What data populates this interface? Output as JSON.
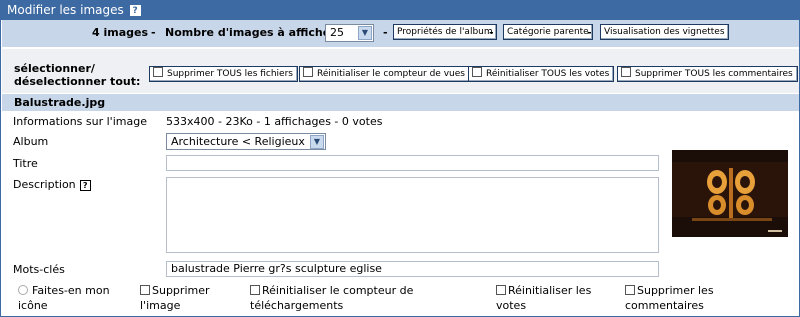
{
  "titlebar": {
    "title": "Modifier les images",
    "help": "?"
  },
  "toolbar": {
    "count": "4 images",
    "sep": "-",
    "per_page_label": "Nombre d'images à afficher",
    "per_page_value": "25",
    "album_props": "Propriétés de l'album",
    "parent_category": "Catégorie parente",
    "view_thumbs": "Visualisation des vignettes"
  },
  "select_all": {
    "label1": "sélectionner/",
    "label2": "déselectionner tout:",
    "delete_files": "Supprimer TOUS les fichiers",
    "reset_views": "Réinitialiser le compteur de vues",
    "reset_votes": "Réinitialiser TOUS les votes",
    "delete_comments": "Supprimer TOUS les commentaires"
  },
  "file": {
    "name": "Balustrade.jpg",
    "info_label": "Informations sur l'image",
    "info_value": "533x400 - 23Ko - 1 affichages - 0 votes",
    "album_label": "Album",
    "album_value": "Architecture < Religieux",
    "title_label": "Titre",
    "title_value": "",
    "description_label": "Description",
    "description_help": "?",
    "description_value": "",
    "keywords_label": "Mots-clés",
    "keywords_value": "balustrade Pierre gr?s sculpture eglise"
  },
  "options": {
    "make_icon": "Faites-en mon icône",
    "delete_image": "Supprimer l'image",
    "reset_downloads": "Réinitialiser le compteur de téléchargements",
    "reset_votes": "Réinitialiser les votes",
    "delete_comments": "Supprimer les commentaires"
  },
  "icons": {
    "help": "help-icon",
    "dropdown": "chevron-down-icon"
  },
  "colors": {
    "header": "#3d6aa2",
    "toolbar": "#c7d6e8",
    "row": "#eef0f3"
  }
}
